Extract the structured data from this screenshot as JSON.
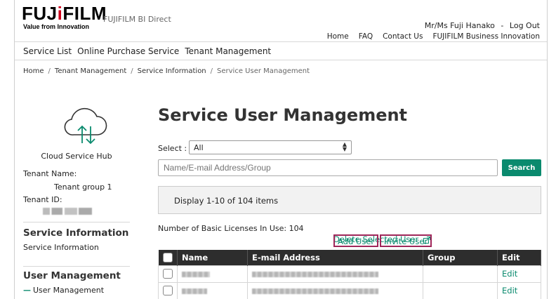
{
  "header": {
    "logo": "FUJIFILM",
    "logo_tagline": "Value from Innovation",
    "brand": "FUJIFILM BI Direct",
    "user_name": "Mr/Ms Fuji Hanako",
    "user_sep": "-",
    "logout": "Log Out",
    "nav": [
      "Home",
      "FAQ",
      "Contact Us",
      "FUJIFILM Business Innovation"
    ]
  },
  "menu": [
    "Service List",
    "Online Purchase Service",
    "Tenant Management"
  ],
  "breadcrumb": {
    "items": [
      "Home",
      "Tenant Management",
      "Service Information"
    ],
    "current": "Service User Management",
    "sep": "/"
  },
  "sidebar": {
    "icon": "cloud-sync-icon",
    "hub_name": "Cloud Service Hub",
    "tenant_name_label": "Tenant Name:",
    "tenant_name_value": "Tenant group 1",
    "tenant_id_label": "Tenant ID:",
    "section1_head": "Service Information",
    "section1_item": "Service Information",
    "section2_head": "User Management",
    "section2_item": "User Management",
    "accent_color": "#0a8a6e"
  },
  "main": {
    "title": "Service User Management",
    "select_label": "Select :",
    "select_value": "All",
    "search_placeholder": "Name/E-mail Address/Group",
    "search_button": "Search",
    "display_text": "Display 1-10 of 104 items",
    "licenses_text": "Number of Basic Licenses In Use: 104",
    "actions": {
      "add_user": "Add User",
      "invite_user": "Invite User",
      "delete_selected": "Delete Selected User"
    },
    "table": {
      "columns": [
        "Name",
        "E-mail Address",
        "Group",
        "Edit"
      ],
      "rows": [
        {
          "group": "",
          "edit": "Edit"
        },
        {
          "group": "",
          "edit": "Edit"
        }
      ]
    }
  }
}
